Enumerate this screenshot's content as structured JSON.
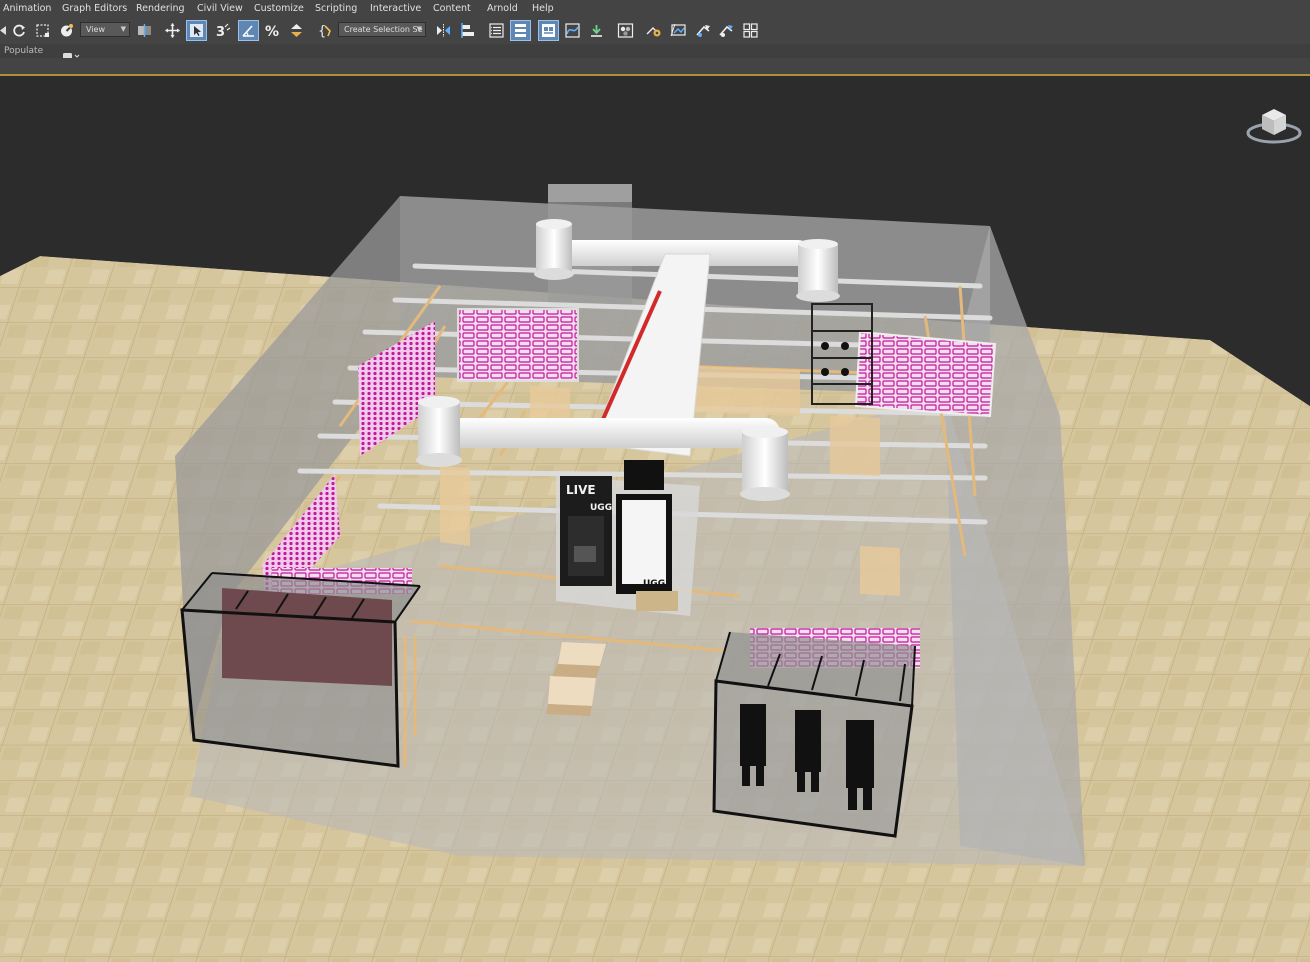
{
  "menu": {
    "items": [
      "Animation",
      "Graph Editors",
      "Rendering",
      "Civil View",
      "Customize",
      "Scripting",
      "Interactive",
      "Content",
      "Arnold",
      "Help"
    ]
  },
  "toolbar": {
    "reference_coord": "View",
    "selection_set": "Create Selection Se"
  },
  "ribbon": {
    "label": "Populate"
  },
  "viewport": {
    "signage": [
      "LIVE",
      "UGG",
      "UGG"
    ],
    "viewcube_icon": "viewcube-icon"
  },
  "colors": {
    "ui_background": "#444444",
    "viewport_background": "#2c2c2c",
    "ribbon_accent": "#b08e3a",
    "active_tool": "#5f87b3",
    "floor_tile": "#d4c39a",
    "shelving_wood": "#e6c08a",
    "product_magenta": "#c2189a",
    "duct_red": "#d02a2a"
  }
}
